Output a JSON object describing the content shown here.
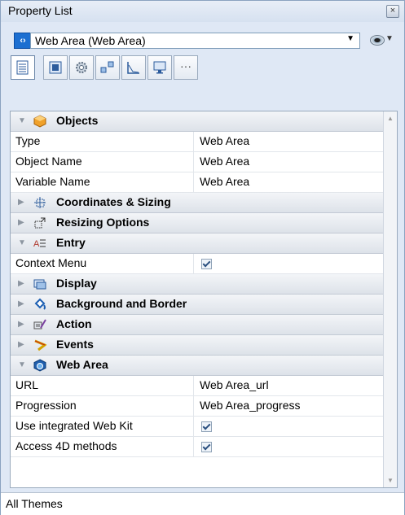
{
  "window": {
    "title": "Property List"
  },
  "selector": {
    "value": "Web Area (Web Area)"
  },
  "toolbar": {
    "more_label": "···"
  },
  "sections": {
    "objects": {
      "label": "Objects"
    },
    "coordinates": {
      "label": "Coordinates & Sizing"
    },
    "resizing": {
      "label": "Resizing Options"
    },
    "entry": {
      "label": "Entry"
    },
    "display": {
      "label": "Display"
    },
    "background": {
      "label": "Background and Border"
    },
    "action": {
      "label": "Action"
    },
    "events": {
      "label": "Events"
    },
    "webarea": {
      "label": "Web Area"
    }
  },
  "props": {
    "type": {
      "key": "Type",
      "value": "Web Area"
    },
    "object_name": {
      "key": "Object Name",
      "value": "Web Area"
    },
    "variable_name": {
      "key": "Variable Name",
      "value": "Web Area"
    },
    "context_menu": {
      "key": "Context Menu",
      "checked": true
    },
    "url": {
      "key": "URL",
      "value": "Web Area_url"
    },
    "progression": {
      "key": "Progression",
      "value": "Web Area_progress"
    },
    "webkit": {
      "key": "Use integrated Web Kit",
      "checked": true
    },
    "access4d": {
      "key": "Access 4D methods",
      "checked": true
    }
  },
  "status": {
    "text": "All Themes"
  }
}
